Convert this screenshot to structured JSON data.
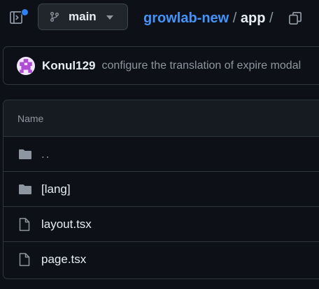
{
  "toolbar": {
    "branch": "main",
    "breadcrumb": {
      "repo": "growlab-new",
      "separator": "/",
      "directory": "app",
      "trailing_separator": "/"
    },
    "icons": {
      "sidebar_toggle": "sidebar-expand-icon",
      "branch": "git-branch-icon",
      "caret": "triangle-down-icon",
      "copy": "copy-icon"
    },
    "notification_dot_color": "#2f81f7"
  },
  "commit": {
    "author": "Konul129",
    "message": "configure the translation of expire modal"
  },
  "file_table": {
    "header": "Name",
    "rows": [
      {
        "name": "..",
        "type": "parent-directory",
        "icon": "folder-icon"
      },
      {
        "name": "[lang]",
        "type": "directory",
        "icon": "folder-icon"
      },
      {
        "name": "layout.tsx",
        "type": "file",
        "icon": "file-icon"
      },
      {
        "name": "page.tsx",
        "type": "file",
        "icon": "file-icon"
      }
    ]
  },
  "colors": {
    "background": "#0d1117",
    "link": "#4493f8",
    "muted": "#8d96a0",
    "border": "#30363d"
  }
}
